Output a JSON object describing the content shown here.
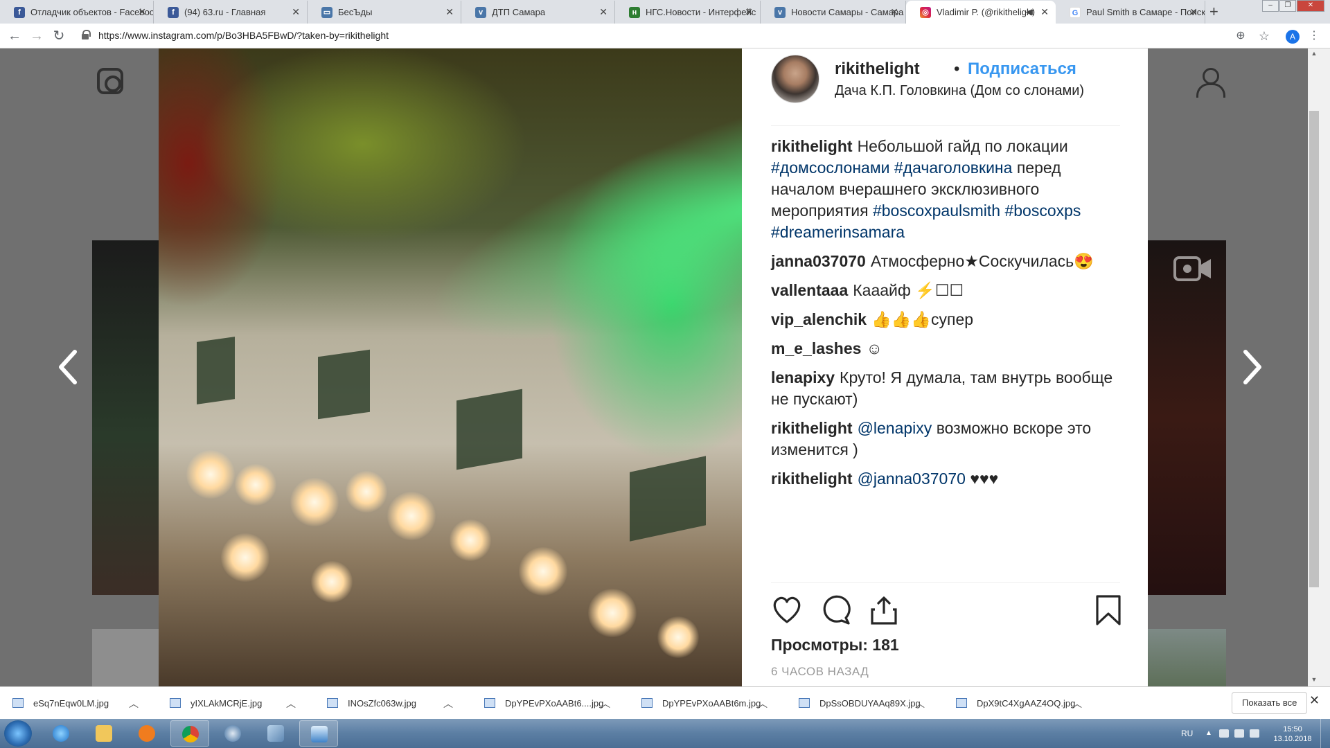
{
  "browser": {
    "tabs": [
      {
        "label": "Отладчик объектов - Facebook",
        "favicon": "facebook-icon",
        "active": false
      },
      {
        "label": "(94) 63.ru - Главная",
        "favicon": "facebook-icon",
        "active": false
      },
      {
        "label": "БесЪды",
        "favicon": "chat-icon",
        "active": false
      },
      {
        "label": "ДТП Самара",
        "favicon": "vk-icon",
        "active": false
      },
      {
        "label": "НГС.Новости - Интерфейс",
        "favicon": "ngs-icon",
        "active": false
      },
      {
        "label": "Новости Самары - Самара",
        "favicon": "vk-icon",
        "active": false
      },
      {
        "label": "Vladimir P. (@rikithelight",
        "favicon": "instagram-icon",
        "active": true,
        "audio": true
      },
      {
        "label": "Paul Smith в Самаре - Поиск",
        "favicon": "google-icon",
        "active": false
      }
    ],
    "url": "https://www.instagram.com/p/Bo3HBA5FBwD/?taken-by=rikithelight",
    "profile_initial": "A"
  },
  "post": {
    "username": "rikithelight",
    "separator": "•",
    "follow_label": "Подписаться",
    "location": "Дача К.П. Головкина (Дом со слонами)",
    "caption": {
      "user": "rikithelight",
      "text1": "Небольшой гайд по локации",
      "tag1": "#домсослонами",
      "tag2": "#дачаголовкина",
      "text2": "перед началом вчерашнего эксклюзивного мероприятия",
      "tag3": "#boscoxpaulsmith",
      "tag4": "#boscoxps",
      "tag5": "#dreamerinsamara"
    },
    "comments": [
      {
        "user": "janna037070",
        "text": "Атмосферно★Соскучилась😍"
      },
      {
        "user": "vallentaaa",
        "text": "Кааайф ⚡☐☐"
      },
      {
        "user": "vip_alenchik",
        "text": "👍👍👍супер"
      },
      {
        "user": "m_e_lashes",
        "text": "☺"
      },
      {
        "user": "lenapixy",
        "text": "Круто! Я думала, там внутрь вообще не пускают)"
      },
      {
        "user": "rikithelight",
        "mention": "@lenapixy",
        "text": "возможно вскоре это изменится )"
      },
      {
        "user": "rikithelight",
        "mention": "@janna037070",
        "text": "♥♥♥"
      }
    ],
    "views_label": "Просмотры: 181",
    "time_ago": "6 ЧАСОВ НАЗАД"
  },
  "downloads": {
    "files": [
      "eSq7nEqw0LM.jpg",
      "yIXLAkMCRjE.jpg",
      "INOsZfc063w.jpg",
      "DpYPEvPXoAABt6....jpg",
      "DpYPEvPXoAABt6m.jpg",
      "DpSsOBDUYAAq89X.jpg",
      "DpX9tC4XgAAZ4OQ.jpg"
    ],
    "show_all_label": "Показать все",
    "close_glyph": "✕"
  },
  "taskbar": {
    "language": "RU",
    "time": "15:50",
    "date": "13.10.2018"
  },
  "colors": {
    "instagram_link": "#003569",
    "follow_blue": "#3897f0"
  }
}
